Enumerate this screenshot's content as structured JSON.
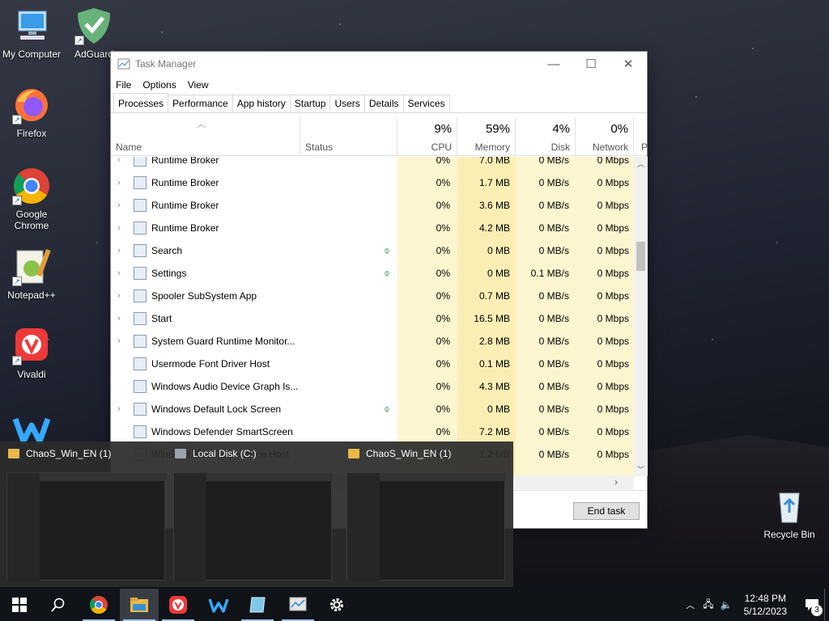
{
  "desktop": {
    "icons": [
      {
        "label": "My Computer"
      },
      {
        "label": "AdGuard"
      },
      {
        "label": "Firefox"
      },
      {
        "label": "Google Chrome"
      },
      {
        "label": "Notepad++"
      },
      {
        "label": "Vivaldi"
      },
      {
        "label": "Recycle Bin"
      }
    ]
  },
  "task_manager": {
    "title": "Task Manager",
    "menu": [
      "File",
      "Options",
      "View"
    ],
    "tabs": [
      "Processes",
      "Performance",
      "App history",
      "Startup",
      "Users",
      "Details",
      "Services"
    ],
    "active_tab": "Processes",
    "columns": {
      "name": "Name",
      "status": "Status",
      "cpu": {
        "pct": "9%",
        "label": "CPU"
      },
      "memory": {
        "pct": "59%",
        "label": "Memory"
      },
      "disk": {
        "pct": "4%",
        "label": "Disk"
      },
      "network": {
        "pct": "0%",
        "label": "Network"
      },
      "more": "P"
    },
    "processes": [
      {
        "name": "Runtime Broker",
        "expand": true,
        "leaf": false,
        "cpu": "0%",
        "mem": "7.0 MB",
        "disk": "0 MB/s",
        "net": "0 Mbps"
      },
      {
        "name": "Runtime Broker",
        "expand": true,
        "leaf": false,
        "cpu": "0%",
        "mem": "1.7 MB",
        "disk": "0 MB/s",
        "net": "0 Mbps"
      },
      {
        "name": "Runtime Broker",
        "expand": true,
        "leaf": false,
        "cpu": "0%",
        "mem": "3.6 MB",
        "disk": "0 MB/s",
        "net": "0 Mbps"
      },
      {
        "name": "Runtime Broker",
        "expand": true,
        "leaf": false,
        "cpu": "0%",
        "mem": "4.2 MB",
        "disk": "0 MB/s",
        "net": "0 Mbps"
      },
      {
        "name": "Search",
        "expand": true,
        "leaf": true,
        "cpu": "0%",
        "mem": "0 MB",
        "disk": "0 MB/s",
        "net": "0 Mbps"
      },
      {
        "name": "Settings",
        "expand": true,
        "leaf": true,
        "cpu": "0%",
        "mem": "0 MB",
        "disk": "0.1 MB/s",
        "net": "0 Mbps"
      },
      {
        "name": "Spooler SubSystem App",
        "expand": true,
        "leaf": false,
        "cpu": "0%",
        "mem": "0.7 MB",
        "disk": "0 MB/s",
        "net": "0 Mbps"
      },
      {
        "name": "Start",
        "expand": true,
        "leaf": false,
        "cpu": "0%",
        "mem": "16.5 MB",
        "disk": "0 MB/s",
        "net": "0 Mbps"
      },
      {
        "name": "System Guard Runtime Monitor...",
        "expand": true,
        "leaf": false,
        "cpu": "0%",
        "mem": "2.8 MB",
        "disk": "0 MB/s",
        "net": "0 Mbps"
      },
      {
        "name": "Usermode Font Driver Host",
        "expand": false,
        "leaf": false,
        "cpu": "0%",
        "mem": "0.1 MB",
        "disk": "0 MB/s",
        "net": "0 Mbps"
      },
      {
        "name": "Windows Audio Device Graph Is...",
        "expand": false,
        "leaf": false,
        "cpu": "0%",
        "mem": "4.3 MB",
        "disk": "0 MB/s",
        "net": "0 Mbps"
      },
      {
        "name": "Windows Default Lock Screen",
        "expand": true,
        "leaf": true,
        "cpu": "0%",
        "mem": "0 MB",
        "disk": "0 MB/s",
        "net": "0 Mbps"
      },
      {
        "name": "Windows Defender SmartScreen",
        "expand": false,
        "leaf": false,
        "cpu": "0%",
        "mem": "7.2 MB",
        "disk": "0 MB/s",
        "net": "0 Mbps"
      },
      {
        "name": "Windows Shell Experience Host",
        "expand": false,
        "leaf": false,
        "cpu": "0%",
        "mem": "1.2 MB",
        "disk": "0 MB/s",
        "net": "0 Mbps"
      }
    ],
    "end_task": "End task"
  },
  "thumbnails": [
    {
      "title": "ChaoS_Win_EN (1)"
    },
    {
      "title": "Local Disk (C:)"
    },
    {
      "title": "ChaoS_Win_EN (1)"
    }
  ],
  "taskbar": {
    "apps": [
      "start-icon",
      "search-icon",
      "chrome-icon",
      "file-explorer-icon",
      "vivaldi-icon",
      "app-w-icon",
      "app-blue-icon",
      "task-manager-icon",
      "settings-icon"
    ],
    "time": "12:48 PM",
    "date": "5/12/2023",
    "notifications": "3"
  }
}
